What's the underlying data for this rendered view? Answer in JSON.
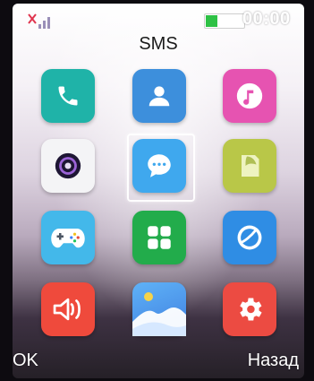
{
  "status": {
    "time": "00:00",
    "signal_icon": "no-signal-icon",
    "battery_icon": "battery-icon",
    "battery_level": 0.3
  },
  "screen": {
    "title": "SMS"
  },
  "apps": [
    {
      "name": "phone",
      "icon": "phone-icon",
      "color": "#1fb3a8"
    },
    {
      "name": "contacts",
      "icon": "contacts-icon",
      "color": "#3d8fdc"
    },
    {
      "name": "music",
      "icon": "music-icon",
      "color": "#e653b1"
    },
    {
      "name": "camera",
      "icon": "camera-icon",
      "color": "#f4f4f6"
    },
    {
      "name": "messages",
      "icon": "message-icon",
      "color": "#3fa8ee",
      "selected": true
    },
    {
      "name": "notes",
      "icon": "note-icon",
      "color": "#b9c748"
    },
    {
      "name": "games",
      "icon": "gamepad-icon",
      "color": "#43b8ea"
    },
    {
      "name": "apps",
      "icon": "apps-grid-icon",
      "color": "#22ac4b"
    },
    {
      "name": "browser",
      "icon": "planet-icon",
      "color": "#2f8de4"
    },
    {
      "name": "sound",
      "icon": "speaker-icon",
      "color": "#ef4a3c"
    },
    {
      "name": "gallery",
      "icon": "gallery-icon",
      "color": "#4a9af2"
    },
    {
      "name": "settings",
      "icon": "gear-icon",
      "color": "#ec4b42"
    }
  ],
  "softkeys": {
    "left": "OK",
    "right": "Назад"
  }
}
